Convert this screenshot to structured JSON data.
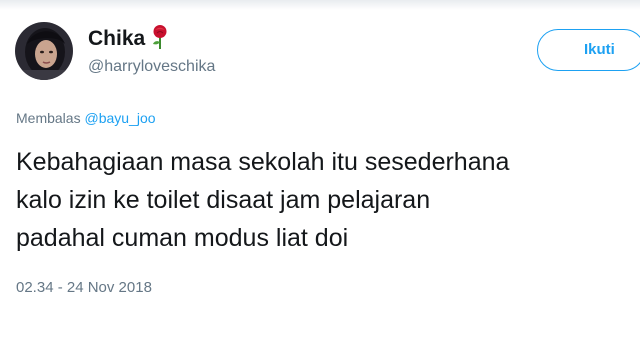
{
  "user": {
    "display_name": "Chika",
    "handle": "@harryloveschika",
    "avatar_icon": "profile-photo",
    "name_emoji_icon": "rose-icon"
  },
  "follow_button": {
    "label": "Ikuti"
  },
  "reply": {
    "prefix": "Membalas",
    "mention": "@bayu_joo"
  },
  "tweet": {
    "lines": [
      "Kebahagiaan masa sekolah itu sesederhana",
      "kalo izin ke toilet disaat jam pelajaran",
      "padahal cuman modus liat doi"
    ]
  },
  "timestamp": "02.34 - 24 Nov 2018",
  "colors": {
    "accent": "#1da1f2",
    "text": "#14171a",
    "secondary_text": "#657786"
  }
}
